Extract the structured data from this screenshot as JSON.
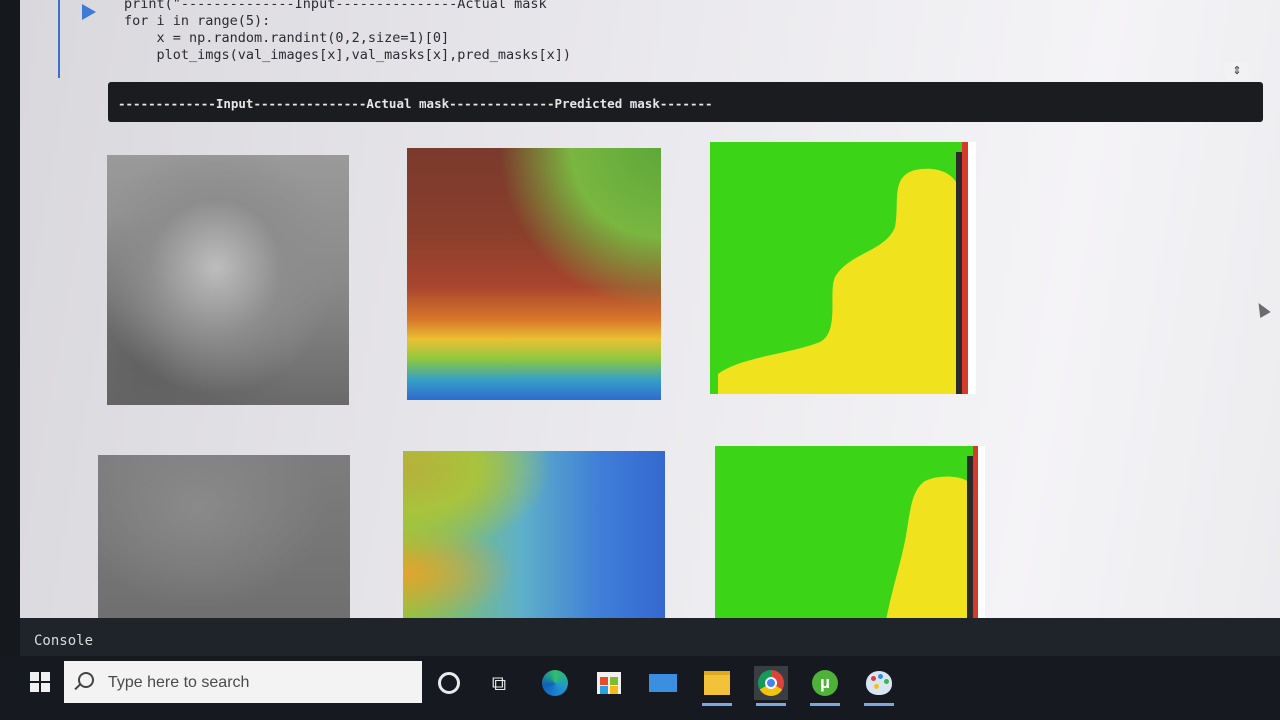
{
  "notebook": {
    "code_lines": [
      "print(\"--------------Input---------------Actual mask",
      "for i in range(5):",
      "    x = np.random.randint(0,2,size=1)[0]",
      "    plot_imgs(val_images[x],val_masks[x],pred_masks[x])"
    ],
    "output_header": "-------------Input---------------Actual mask--------------Predicted mask-------",
    "images": [
      {
        "name": "Input",
        "kind": "grayscale"
      },
      {
        "name": "Actual mask",
        "kind": "elevation"
      },
      {
        "name": "Predicted mask",
        "kind": "prediction"
      }
    ]
  },
  "console": {
    "label": "Console"
  },
  "taskbar": {
    "search_placeholder": "Type here to search",
    "apps": [
      "cortana",
      "task-view",
      "edge",
      "store",
      "mail",
      "file-explorer",
      "chrome",
      "utorrent",
      "paint"
    ]
  },
  "colors": {
    "pred_green": "#3bd416",
    "pred_yellow": "#f0e21c",
    "output_bg": "#1b1c20"
  }
}
